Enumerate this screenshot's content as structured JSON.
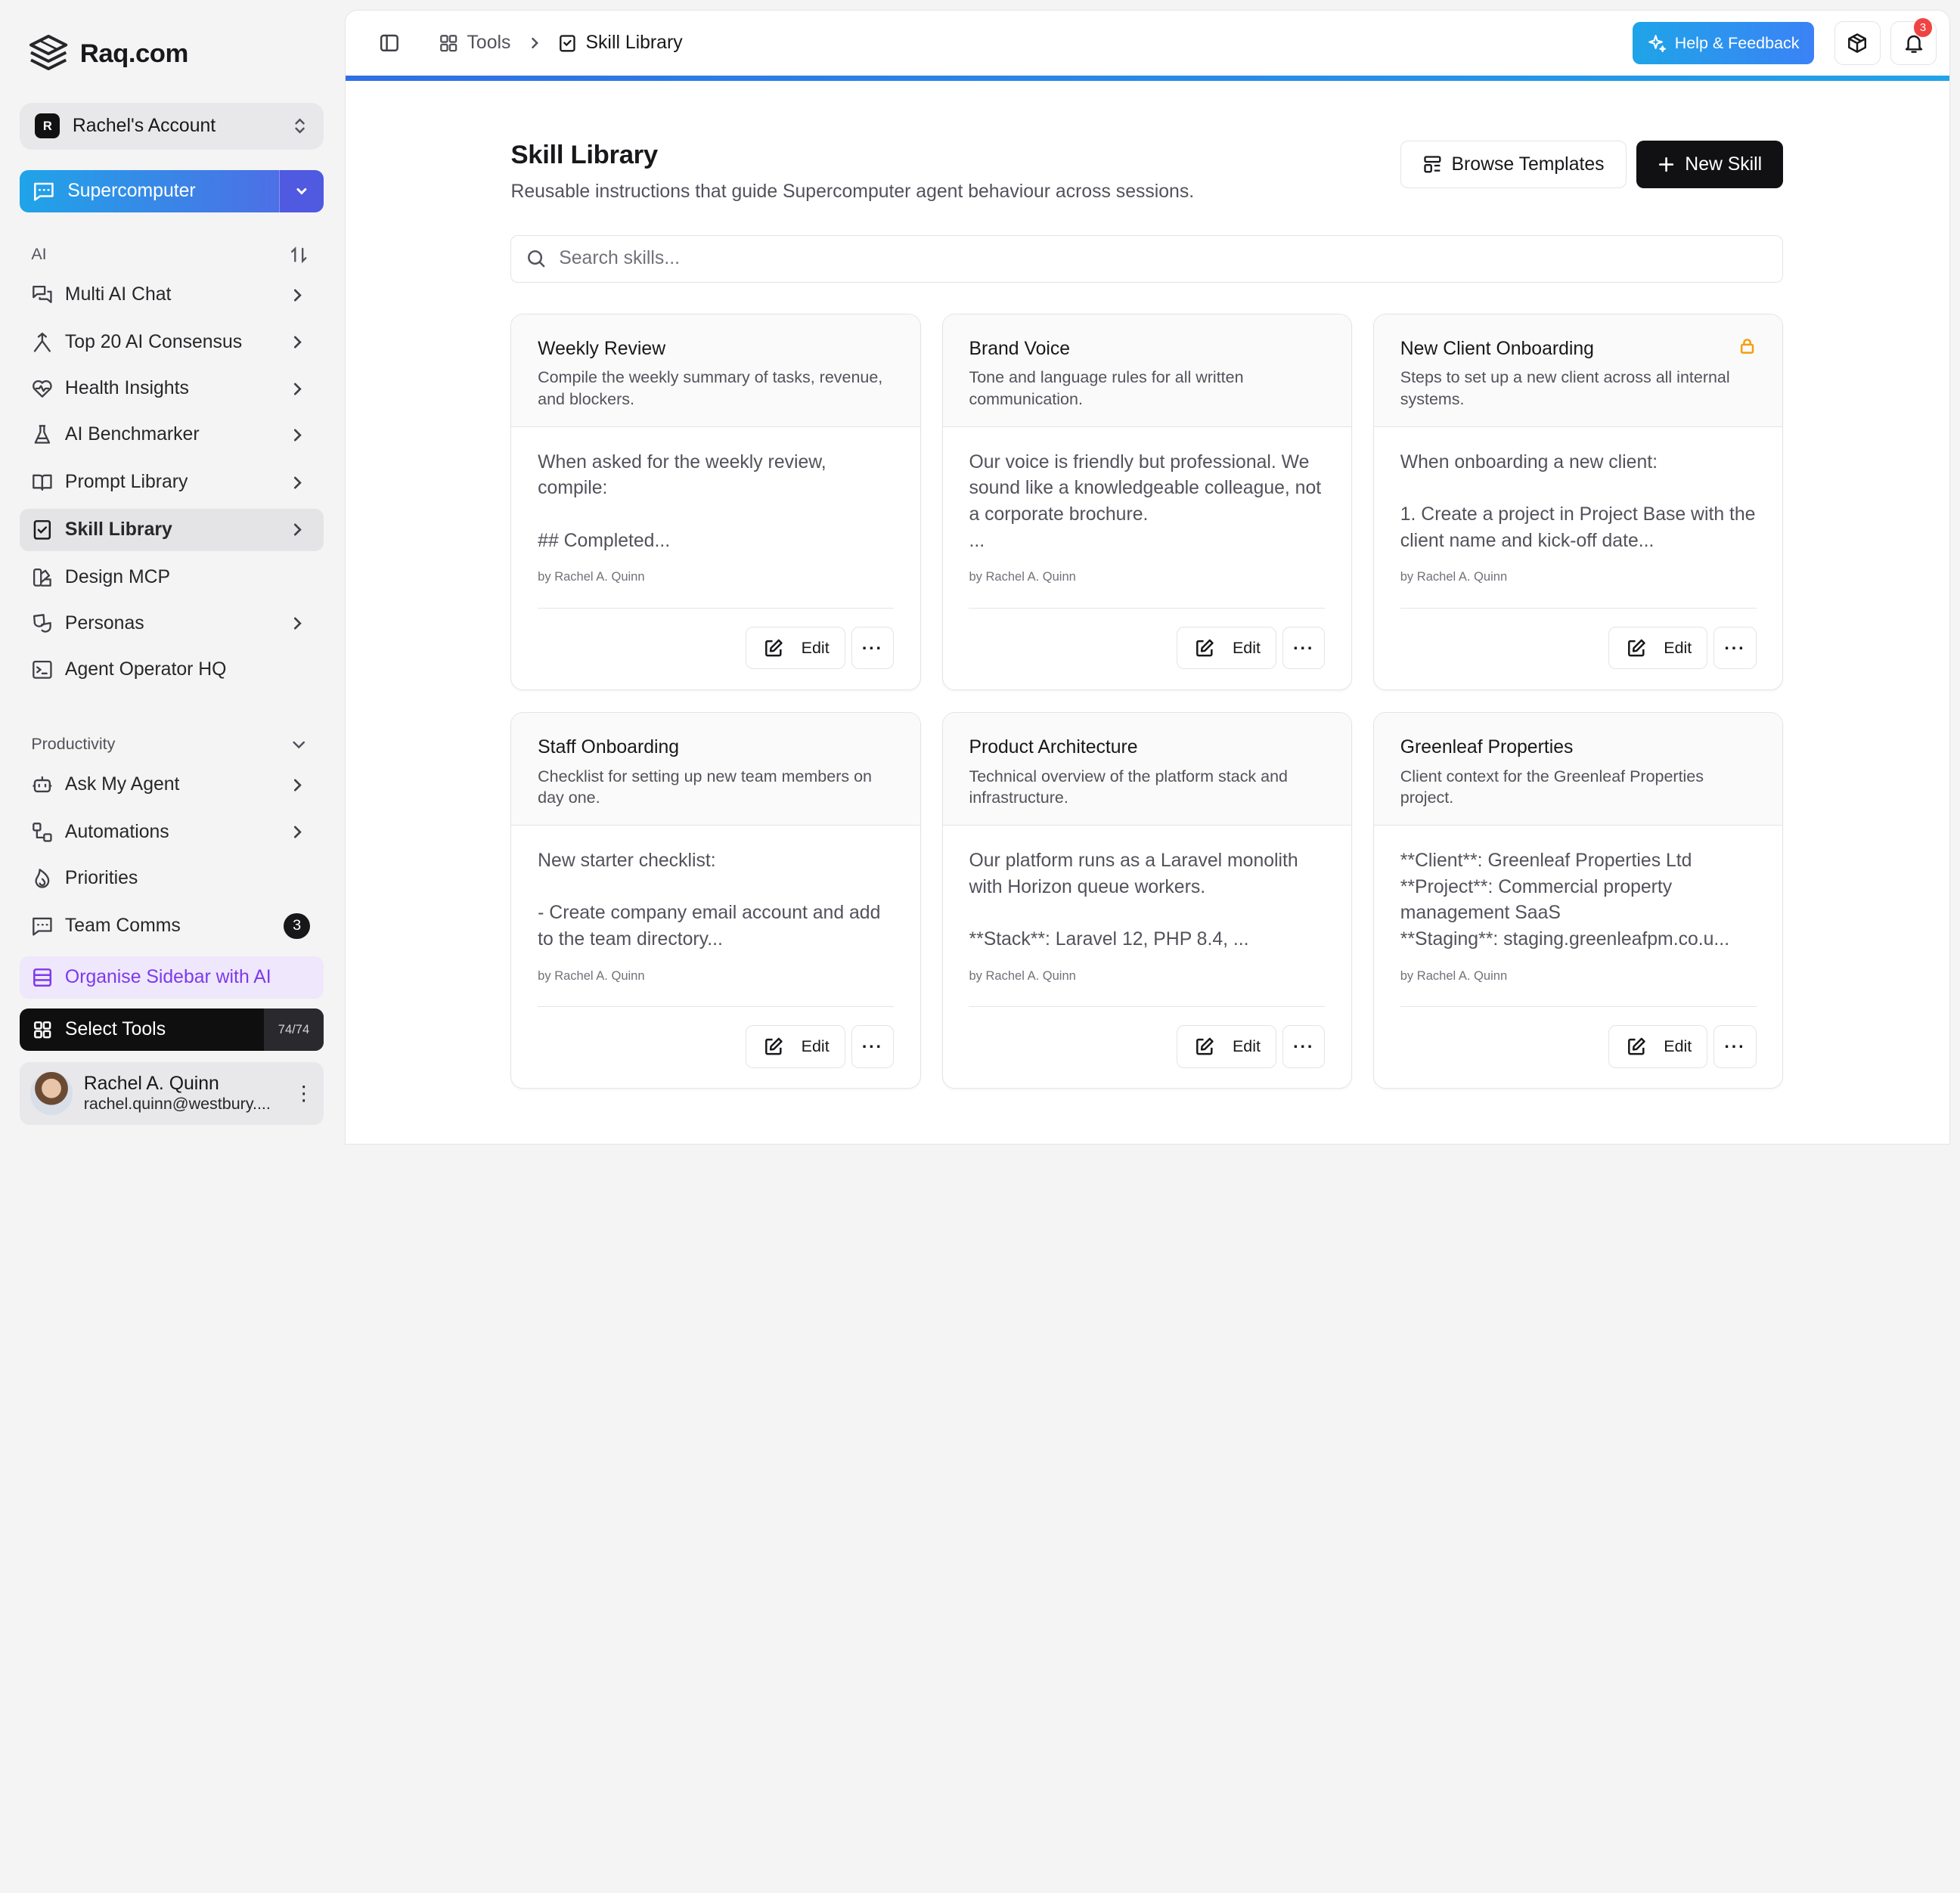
{
  "app": {
    "brand": "Raq.com"
  },
  "sidebar": {
    "account": {
      "initial": "R",
      "name": "Rachel's Account"
    },
    "mode": {
      "label": "Supercomputer"
    },
    "ai_section_label": "AI",
    "ai_items": [
      {
        "label": "Multi AI Chat",
        "icon": "chat-bubbles-icon",
        "has_chevron": true
      },
      {
        "label": "Top 20 AI Consensus",
        "icon": "consensus-icon",
        "has_chevron": true
      },
      {
        "label": "Health Insights",
        "icon": "heart-pulse-icon",
        "has_chevron": true
      },
      {
        "label": "AI Benchmarker",
        "icon": "flask-icon",
        "has_chevron": true
      },
      {
        "label": "Prompt Library",
        "icon": "book-open-icon",
        "has_chevron": true
      },
      {
        "label": "Skill Library",
        "icon": "skill-book-icon",
        "has_chevron": true,
        "active": true
      },
      {
        "label": "Design MCP",
        "icon": "swatch-icon",
        "has_chevron": false
      },
      {
        "label": "Personas",
        "icon": "masks-icon",
        "has_chevron": true
      },
      {
        "label": "Agent Operator HQ",
        "icon": "terminal-icon",
        "has_chevron": false
      }
    ],
    "productivity_section_label": "Productivity",
    "productivity_items": [
      {
        "label": "Ask My Agent",
        "icon": "robot-icon",
        "has_chevron": true
      },
      {
        "label": "Automations",
        "icon": "workflow-icon",
        "has_chevron": true
      },
      {
        "label": "Priorities",
        "icon": "flame-icon",
        "has_chevron": false
      },
      {
        "label": "Team Comms",
        "icon": "message-square-icon",
        "badge": "3"
      }
    ],
    "organise": {
      "label": "Organise Sidebar with AI"
    },
    "select_tools": {
      "label": "Select Tools",
      "count": "74/74"
    },
    "user": {
      "name": "Rachel A. Quinn",
      "email": "rachel.quinn@westbury...."
    }
  },
  "header": {
    "breadcrumb": {
      "root": "Tools",
      "current": "Skill Library"
    },
    "help_label": "Help & Feedback",
    "notification_count": "3"
  },
  "page": {
    "title": "Skill Library",
    "subtitle": "Reusable instructions that guide Supercomputer agent behaviour across sessions.",
    "browse_label": "Browse Templates",
    "new_label": "New Skill",
    "search_placeholder": "Search skills...",
    "edit_label": "Edit"
  },
  "skills": [
    {
      "title": "Weekly Review",
      "description": "Compile the weekly summary of tasks, revenue, and blockers.",
      "body": "When asked for the weekly review, compile:\n\n## Completed...",
      "author": "by Rachel A. Quinn",
      "locked": false
    },
    {
      "title": "Brand Voice",
      "description": "Tone and language rules for all written communication.",
      "body": "Our voice is friendly but professional. We sound like a knowledgeable colleague, not a corporate brochure.\n...",
      "author": "by Rachel A. Quinn",
      "locked": false
    },
    {
      "title": "New Client Onboarding",
      "description": "Steps to set up a new client across all internal systems.",
      "body": "When onboarding a new client:\n\n1. Create a project in Project Base with the client name and kick-off date...",
      "author": "by Rachel A. Quinn",
      "locked": true
    },
    {
      "title": "Staff Onboarding",
      "description": "Checklist for setting up new team members on day one.",
      "body": "New starter checklist:\n\n- Create company email account and add to the team directory...",
      "author": "by Rachel A. Quinn",
      "locked": false
    },
    {
      "title": "Product Architecture",
      "description": "Technical overview of the platform stack and infrastructure.",
      "body": "Our platform runs as a Laravel monolith with Horizon queue workers.\n\n**Stack**: Laravel 12, PHP 8.4, ...",
      "author": "by Rachel A. Quinn",
      "locked": false
    },
    {
      "title": "Greenleaf Properties",
      "description": "Client context for the Greenleaf Properties project.",
      "body": "**Client**: Greenleaf Properties Ltd\n**Project**: Commercial property management SaaS\n**Staging**: staging.greenleafpm.co.u...",
      "author": "by Rachel A. Quinn",
      "locked": false
    }
  ],
  "colors": {
    "accent_blue": "#1fa4e8",
    "accent_indigo": "#4f5ae0",
    "organise_purple": "#7c3aed",
    "lock_amber": "#f59e0b",
    "notification_red": "#ef4444"
  }
}
